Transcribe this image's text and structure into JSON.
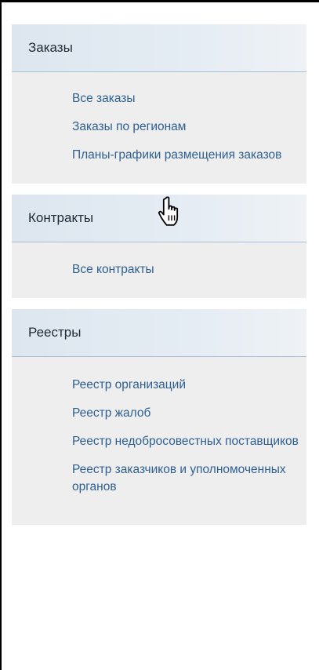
{
  "menu": {
    "sections": [
      {
        "title": "Заказы",
        "items": [
          {
            "label": "Все заказы"
          },
          {
            "label": "Заказы по регионам"
          },
          {
            "label": "Планы-графики размещения заказов"
          }
        ]
      },
      {
        "title": "Контракты",
        "items": [
          {
            "label": "Все контракты"
          }
        ]
      },
      {
        "title": "Реестры",
        "items": [
          {
            "label": "Реестр организаций"
          },
          {
            "label": "Реестр жалоб"
          },
          {
            "label": "Реестр недобросовестных поставщиков"
          },
          {
            "label": "Реестр заказчиков и уполномоченных органов"
          }
        ]
      }
    ]
  },
  "cursor": {
    "icon": "hand-pointer-icon"
  },
  "colors": {
    "link": "#2d5f93",
    "header_text": "#1f2b36",
    "panel_bg": "#eeeeee",
    "header_bg": "#e2eaf2",
    "header_border": "#a9bfd6"
  }
}
